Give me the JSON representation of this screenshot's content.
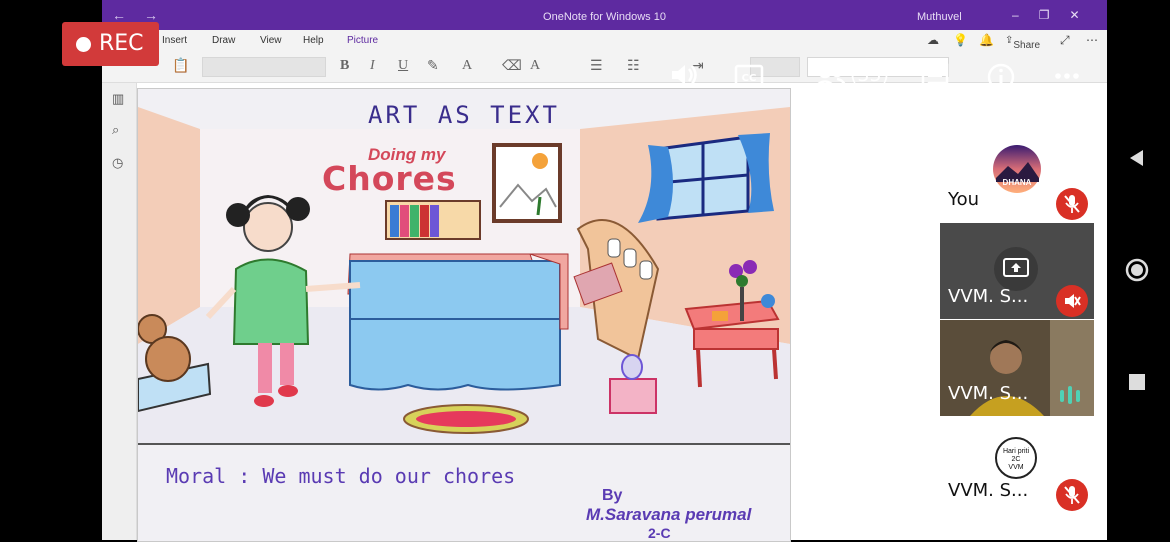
{
  "window": {
    "title": "OneNote for Windows 10",
    "user": "Muthuvel",
    "nav_icons": [
      "back-arrow-icon",
      "forward-arrow-icon"
    ],
    "window_controls": [
      "minimize-icon",
      "restore-icon",
      "close-icon"
    ]
  },
  "menu": {
    "items": [
      "Insert",
      "Draw",
      "View",
      "Help",
      "Picture"
    ],
    "active": "Picture",
    "share_label": "Share"
  },
  "toolbar": {
    "format_buttons": [
      "B",
      "I",
      "U"
    ]
  },
  "drawing": {
    "title": "ART AS TEXT",
    "subtitle_small": "Doing my",
    "subtitle_large": "Chores",
    "moral": "Moral : We must do our chores",
    "by": "By",
    "author": "M.Saravana perumal",
    "class": "2-C"
  },
  "meet": {
    "rec_label": "REC",
    "participant_count": "(35)",
    "controls": [
      "speaker-icon",
      "captions-icon",
      "people-icon",
      "chat-icon",
      "info-icon",
      "more-icon"
    ],
    "tiles": [
      {
        "name": "You",
        "avatar_text": "DHANA",
        "muted": true
      },
      {
        "name": "VVM. S...",
        "presenting": true,
        "muted": true
      },
      {
        "name": "VVM. S...",
        "speaking": true,
        "muted": false
      },
      {
        "name": "VVM. S...",
        "avatar_lines": [
          "Hari priti",
          "2C",
          "VVM"
        ],
        "muted": true
      }
    ]
  },
  "colors": {
    "title_bar": "#5e2aa0",
    "rec": "#d23a3a",
    "mute": "#d93025",
    "speaking": "#4fd1b5",
    "art_ink": "#3a2d8c",
    "art_red": "#d4485a"
  }
}
